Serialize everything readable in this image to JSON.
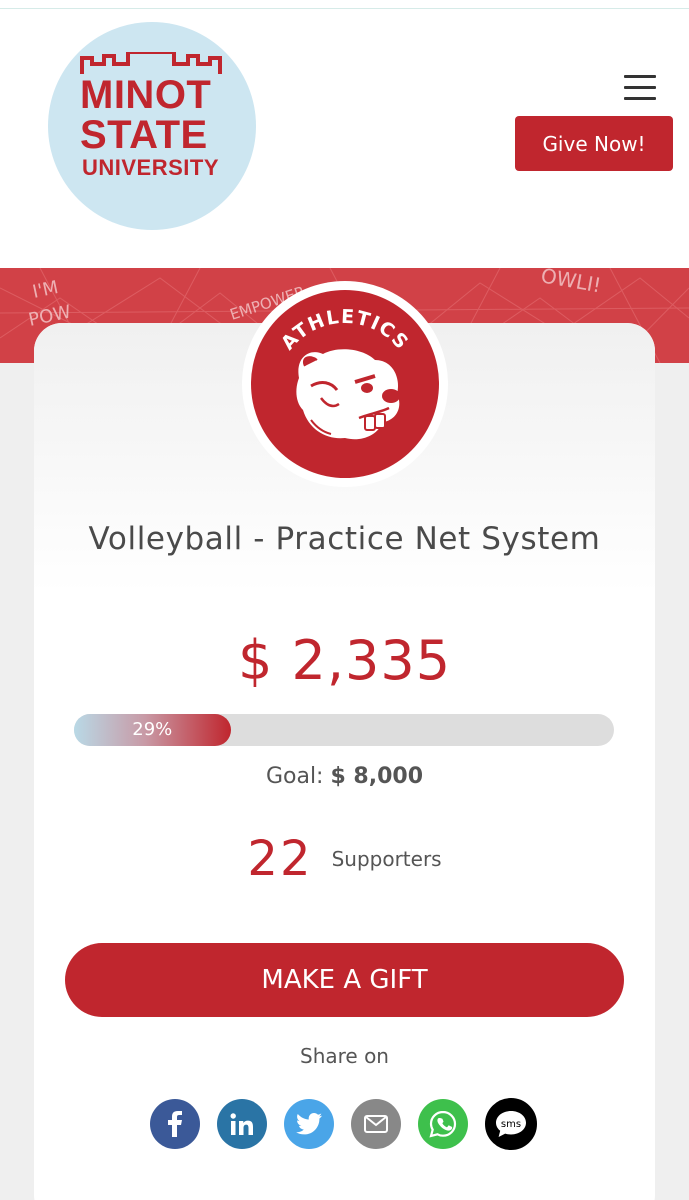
{
  "header": {
    "logo": {
      "line1": "MINOT",
      "line2": "STATE",
      "line3": "UNIVERSITY"
    },
    "menu_icon": "hamburger-menu-icon",
    "give_now_label": "Give Now!"
  },
  "banner": {
    "scribbles": [
      "I'M",
      "POW",
      "EMPOWER",
      "OWLI!"
    ]
  },
  "badge": {
    "text": "ATHLETICS",
    "icon": "beaver-mascot-icon"
  },
  "campaign": {
    "title": "Volleyball - Practice Net System",
    "raised": "$ 2,335",
    "progress_label": "29%",
    "progress_fraction": 0.29,
    "goal_label": "Goal:",
    "goal_value": "$ 8,000",
    "supporters_count": "22",
    "supporters_label": "Supporters",
    "make_gift_label": "MAKE A GIFT",
    "share_label": "Share on"
  },
  "share": [
    {
      "name": "facebook",
      "icon": "facebook-icon",
      "color": "#3b5998"
    },
    {
      "name": "linkedin",
      "icon": "linkedin-icon",
      "color": "#2a74a5"
    },
    {
      "name": "twitter",
      "icon": "twitter-icon",
      "color": "#4aa5e8"
    },
    {
      "name": "email",
      "icon": "email-icon",
      "color": "#888888"
    },
    {
      "name": "whatsapp",
      "icon": "whatsapp-icon",
      "color": "#3ec04c"
    },
    {
      "name": "sms",
      "icon": "sms-icon",
      "color": "#000000",
      "text": "sms"
    }
  ],
  "colors": {
    "brand_red": "#c0262e",
    "logo_bg": "#cde6f1",
    "progress_track": "#dddddd"
  }
}
